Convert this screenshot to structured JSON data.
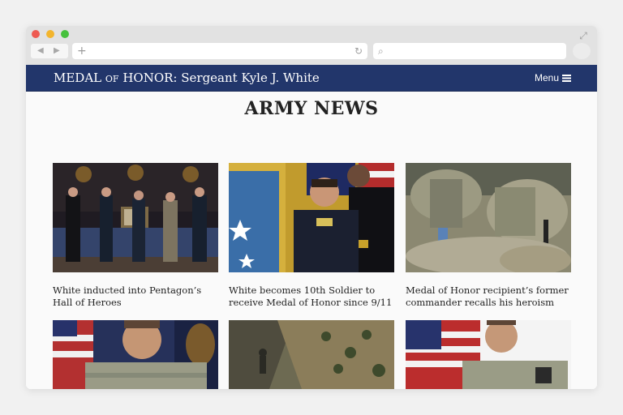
{
  "browser": {
    "nav_back": "◀",
    "nav_forward": "▶",
    "address_plus": "+",
    "reload_icon": "↻",
    "search_icon": "⌕",
    "expand_icon": "⤢"
  },
  "header": {
    "title_part1": "MEDAL ",
    "title_small": "OF",
    "title_part2": " HONOR: Sergeant Kyle J. White",
    "menu_label": "Menu"
  },
  "main": {
    "title": "ARMY NEWS",
    "cards": [
      {
        "caption": "White inducted into Pentagon’s Hall of Heroes"
      },
      {
        "caption": "White becomes 10th Soldier to receive Medal of Honor since 9/11"
      },
      {
        "caption": "Medal of Honor recipient’s former commander recalls his heroism"
      },
      {
        "caption": ""
      },
      {
        "caption": ""
      },
      {
        "caption": ""
      }
    ]
  },
  "colors": {
    "header_bg": "#22366b",
    "page_bg": "#fafafa"
  }
}
